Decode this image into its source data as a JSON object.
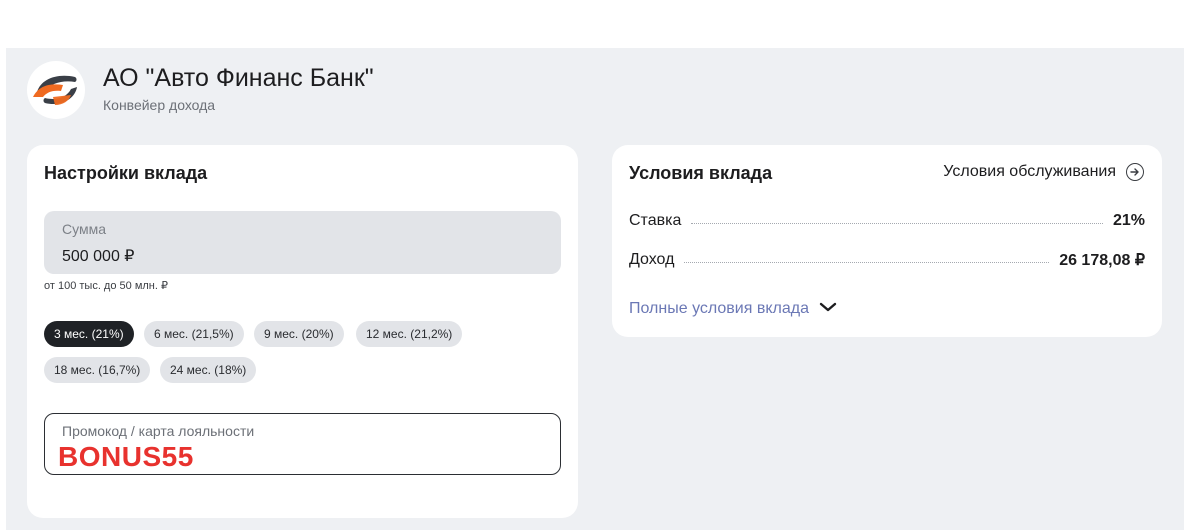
{
  "header": {
    "bank_name": "АО \"Авто Финанс Банк\"",
    "product_name": "Конвейер дохода",
    "logo_icon": "auto-finance-bank-logo",
    "logo_colors": {
      "orange": "#ef6a21",
      "dark": "#3a3f47"
    }
  },
  "settings": {
    "title": "Настройки вклада",
    "amount": {
      "label": "Сумма",
      "value": "500 000 ₽",
      "hint": "от 100 тыс. до 50 млн. ₽"
    },
    "terms": [
      {
        "label": "3 мес. (21%)",
        "selected": true
      },
      {
        "label": "6 мес. (21,5%)",
        "selected": false
      },
      {
        "label": "9 мес. (20%)",
        "selected": false
      },
      {
        "label": "12 мес. (21,2%)",
        "selected": false
      },
      {
        "label": "18 мес. (16,7%)",
        "selected": false
      },
      {
        "label": "24 мес. (18%)",
        "selected": false
      }
    ],
    "promo": {
      "label": "Промокод / карта лояльности",
      "value": "BONUS55",
      "value_color": "#e8322e"
    }
  },
  "conditions": {
    "title": "Условия вклада",
    "service_link": "Условия обслуживания",
    "service_icon": "arrow-right-circle-icon",
    "rows": [
      {
        "key": "Ставка",
        "value": "21%"
      },
      {
        "key": "Доход",
        "value": "26 178,08 ₽"
      }
    ],
    "full_link": "Полные условия вклада",
    "full_link_icon": "chevron-down-icon",
    "link_color": "#6b78b5"
  }
}
